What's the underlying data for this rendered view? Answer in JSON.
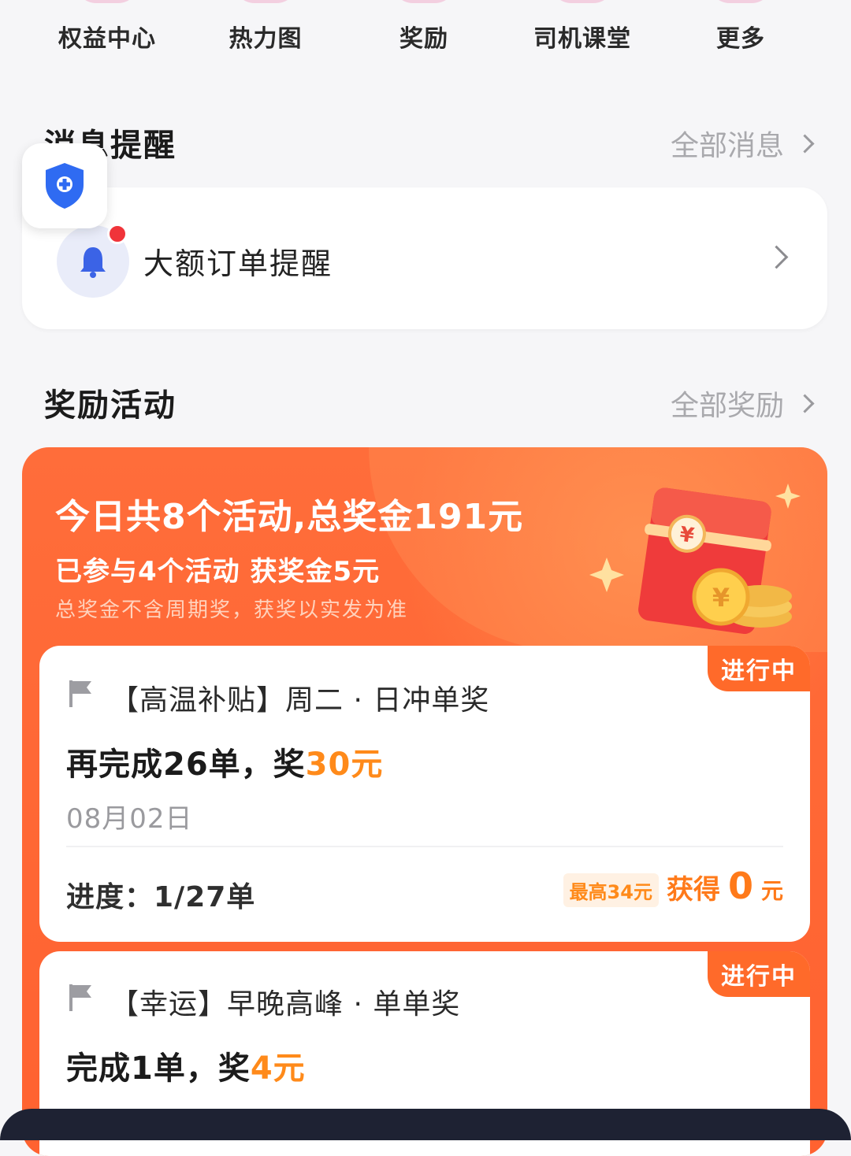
{
  "shortcuts": [
    {
      "label": "权益中心"
    },
    {
      "label": "热力图"
    },
    {
      "label": "奖励"
    },
    {
      "label": "司机课堂"
    },
    {
      "label": "更多"
    }
  ],
  "messages": {
    "title": "消息提醒",
    "more_label": "全部消息",
    "item_text": "大额订单提醒"
  },
  "rewards": {
    "title": "奖励活动",
    "more_label": "全部奖励",
    "headline": "今日共8个活动,总奖金191元",
    "subline": "已参与4个活动 获奖金5元",
    "note": "总奖金不含周期奖，获奖以实发为准",
    "activities": [
      {
        "status": "进行中",
        "title": "【高温补贴】周二 · 日冲单奖",
        "main_prefix": "再完成26单，奖",
        "amount": "30元",
        "date": "08月02日",
        "progress": "进度：1/27单",
        "max_tag": "最高34元",
        "earn_label": "获得",
        "earn_value": "0",
        "earn_unit": "元"
      },
      {
        "status": "进行中",
        "title": "【幸运】早晚高峰 · 单单奖",
        "main_prefix": "完成1单，奖",
        "amount": "4元"
      }
    ]
  },
  "colors": {
    "accent_orange": "#ff6a2a",
    "amount_orange": "#ff8a1a",
    "notification_red": "#f0343a",
    "shield_blue": "#2f6bf2"
  },
  "icons": [
    "shield-plus-icon",
    "bell-icon",
    "flag-icon",
    "chevron-right-icon",
    "red-packet-icon",
    "coin-icon"
  ]
}
